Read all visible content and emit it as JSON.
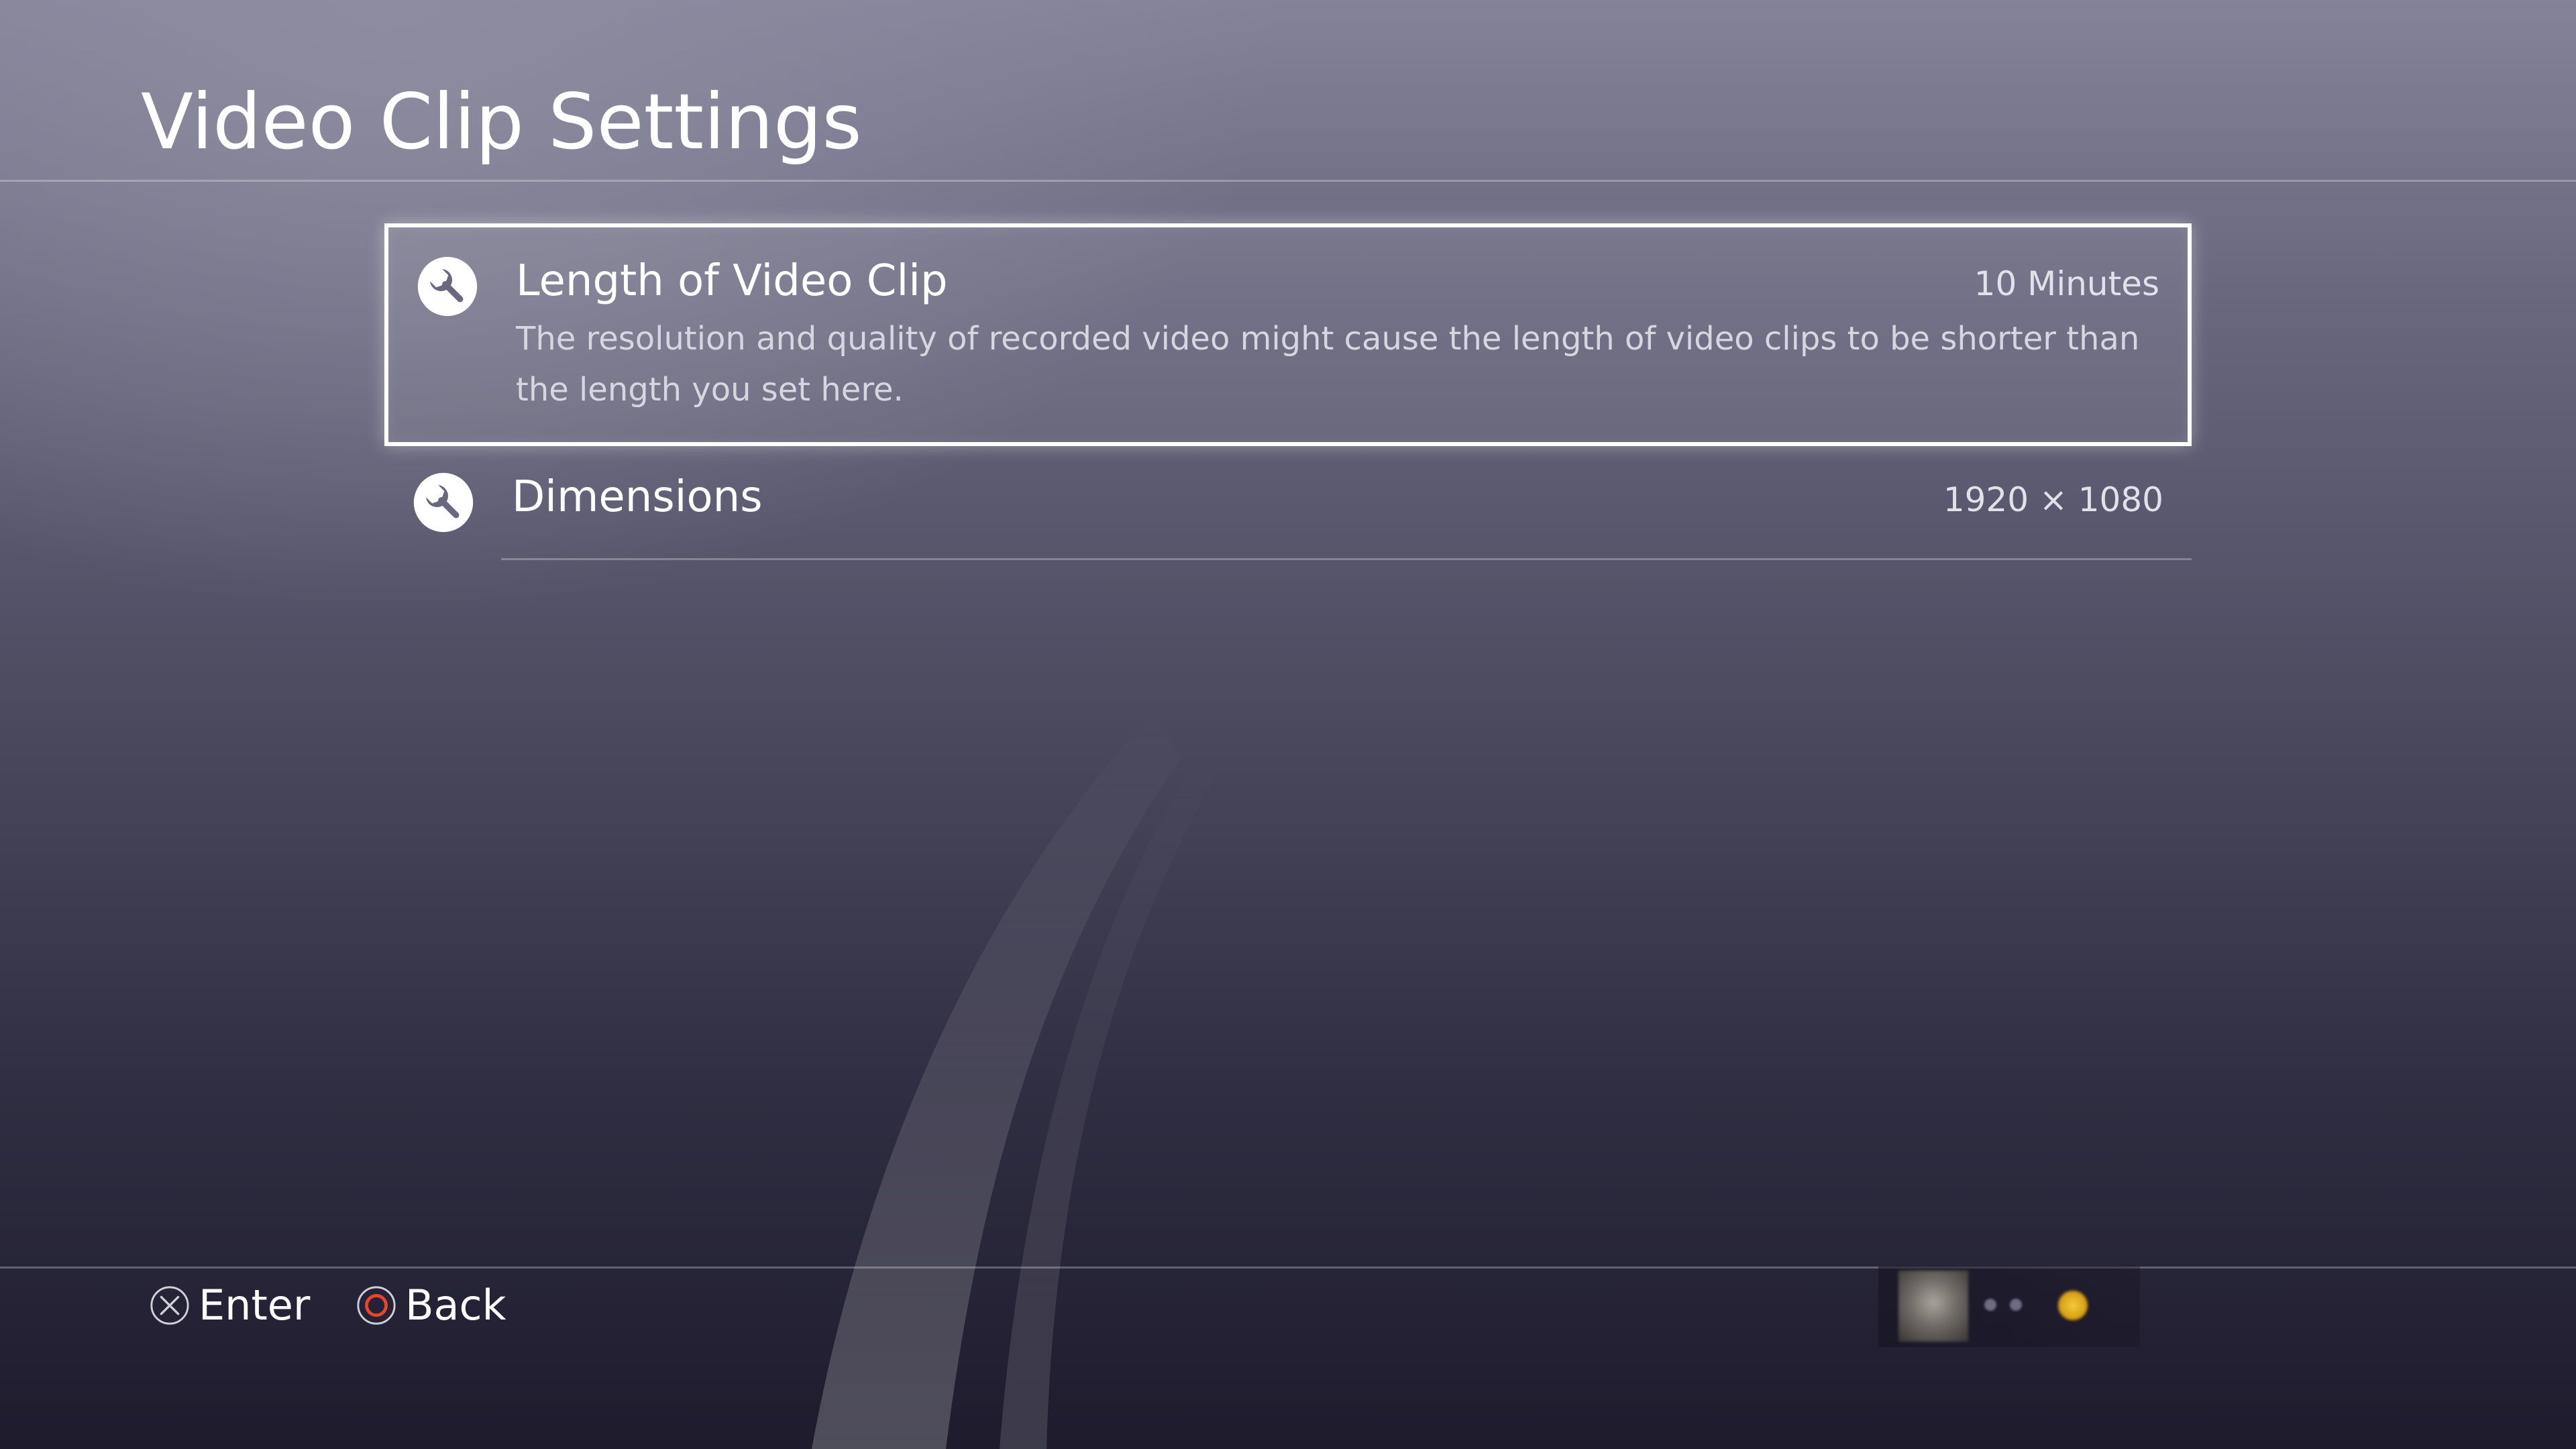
{
  "page": {
    "title": "Video Clip Settings"
  },
  "settings": {
    "items": [
      {
        "label": "Length of Video Clip",
        "value": "10 Minutes",
        "description": "The resolution and quality of recorded video might cause the length of video clips to be shorter than the length you set here.",
        "icon": "wrench-icon",
        "selected": true
      },
      {
        "label": "Dimensions",
        "value": "1920 × 1080",
        "icon": "wrench-icon",
        "selected": false
      }
    ]
  },
  "footer": {
    "enter": {
      "label": "Enter",
      "icon": "cross-button-icon"
    },
    "back": {
      "label": "Back",
      "icon": "circle-button-icon"
    }
  },
  "colors": {
    "accent_circle": "#e8452a",
    "status_online": "#f5c93a",
    "selection_border": "#ffffff"
  }
}
